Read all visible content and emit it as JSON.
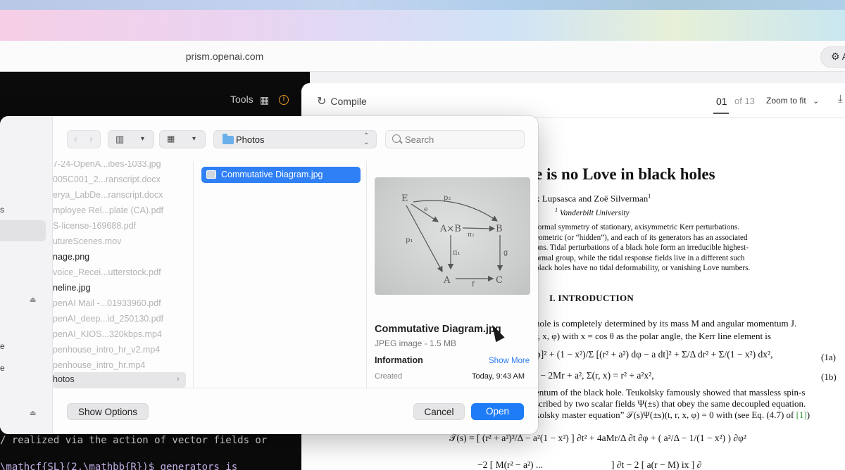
{
  "browser": {
    "url": "prism.openai.com",
    "extension_label": "A"
  },
  "editor": {
    "tools_label": "Tools",
    "code_line_1": "/ realized via the action of vector fields or",
    "code_line_2": "\\mathcf{SL}(2,\\mathbb{R})$ generators is"
  },
  "pdf": {
    "compile_label": "Compile",
    "page_current": "01",
    "page_total": "of 13",
    "zoom_label": "Zoom to fit",
    "title": "e is no Love in black holes",
    "authors": "x Lupsasca and Zoë Silverman",
    "affiliation_mark": "1",
    "affiliation": "Vanderbilt University",
    "abstract_lines": [
      "formal symmetry of stationary, axisymmetric Kerr perturbations.",
      "eometric (or “hidden”), and each of its generators has an associated",
      "ons. Tidal perturbations of a black hole form an irreducible highest-",
      "ormal group, while the tidal response fields live in a different such",
      "black holes have no tidal deformability, or vanishing Love numbers."
    ],
    "section_heading": "I.   INTRODUCTION",
    "body_lines": [
      "hole is completely determined by its mass M and angular momentum J.",
      "r, x, φ) with x = cos θ as the polar angle, the Kerr line element is"
    ],
    "eq_1a_text": "φ]² + (1 − x²)/Σ [(r² + a²) dφ − a dt]² + Σ/Δ dr² + Σ/(1 − x²) dx²,",
    "eq_1a_num": "(1a)",
    "eq_1b_text": "² − 2Mr + a²,       Σ(r, x) = r² + a²x²,",
    "eq_1b_num": "(1b)",
    "body_lines_2": [
      "entum of the black hole. Teukolsky famously showed that massless spin-s",
      "scribed by two scalar fields Ψ(±s) that obey the same decoupled equation.",
      "kolsky master equation” 𝒯(s)Ψ(±s)(t, r, x, φ) = 0 with (see Eq. (4.7) of "
    ],
    "ref_link": "[1]",
    "ref_after": ")",
    "eq_teuk": "𝒯(s) = [ (r² + a²)²/Δ − a²(1 − x²) ] ∂t² + 4aMr/Δ ∂t ∂φ + ( a²/Δ − 1/(1 − x²) ) ∂φ²",
    "eq_teuk_2": "−2 [ M(r² − a²) ...",
    "eq_teuk_3": "] ∂t − 2 [ a(r − M)       ix   ] ∂"
  },
  "dialog": {
    "sidebar_letters": [
      "s",
      "e",
      "e"
    ],
    "location": "Photos",
    "search_placeholder": "Search",
    "files": [
      {
        "name": "7-24-OpenA...ibes-1033.jpg",
        "dim": true
      },
      {
        "name": "005C001_2...ranscript.docx",
        "dim": true
      },
      {
        "name": "erya_LabDe...ranscript.docx",
        "dim": true
      },
      {
        "name": "mployee Rel...plate (CA).pdf",
        "dim": true
      },
      {
        "name": "S-license-169688.pdf",
        "dim": true
      },
      {
        "name": "utureScenes.mov",
        "dim": true
      },
      {
        "name": "nage.png",
        "dim": false
      },
      {
        "name": "voice_Recei...utterstock.pdf",
        "dim": true
      },
      {
        "name": "neline.jpg",
        "dim": false
      },
      {
        "name": "penAI Mail -...01933960.pdf",
        "dim": true
      },
      {
        "name": "penAI_deep...id_250130.pdf",
        "dim": true
      },
      {
        "name": "penAI_KIOS...320kbps.mp4",
        "dim": true
      },
      {
        "name": "penhouse_intro_hr_v2.mp4",
        "dim": true
      },
      {
        "name": "penhouse_intro_hr.mp4",
        "dim": true
      }
    ],
    "folder_row": "hotos",
    "selected_file": "Commutative Diagram.jpg",
    "preview": {
      "name": "Commutative Diagram.jpg",
      "kind": "JPEG image - 1.5 MB",
      "info_label": "Information",
      "show_more": "Show More",
      "created_label": "Created",
      "created_value": "Today, 9:43 AM",
      "diagram_labels": [
        "E",
        "p₂",
        "e",
        "A×B",
        "π₂",
        "B",
        "p₁",
        "π₁",
        "g",
        "A",
        "f",
        "C"
      ]
    },
    "show_options_label": "Show Options",
    "cancel_label": "Cancel",
    "open_label": "Open"
  },
  "colors": {
    "accent": "#1e7cf7",
    "selection": "#2f7ff5",
    "warning": "#e89a24",
    "link_green": "#3a9a3a"
  }
}
